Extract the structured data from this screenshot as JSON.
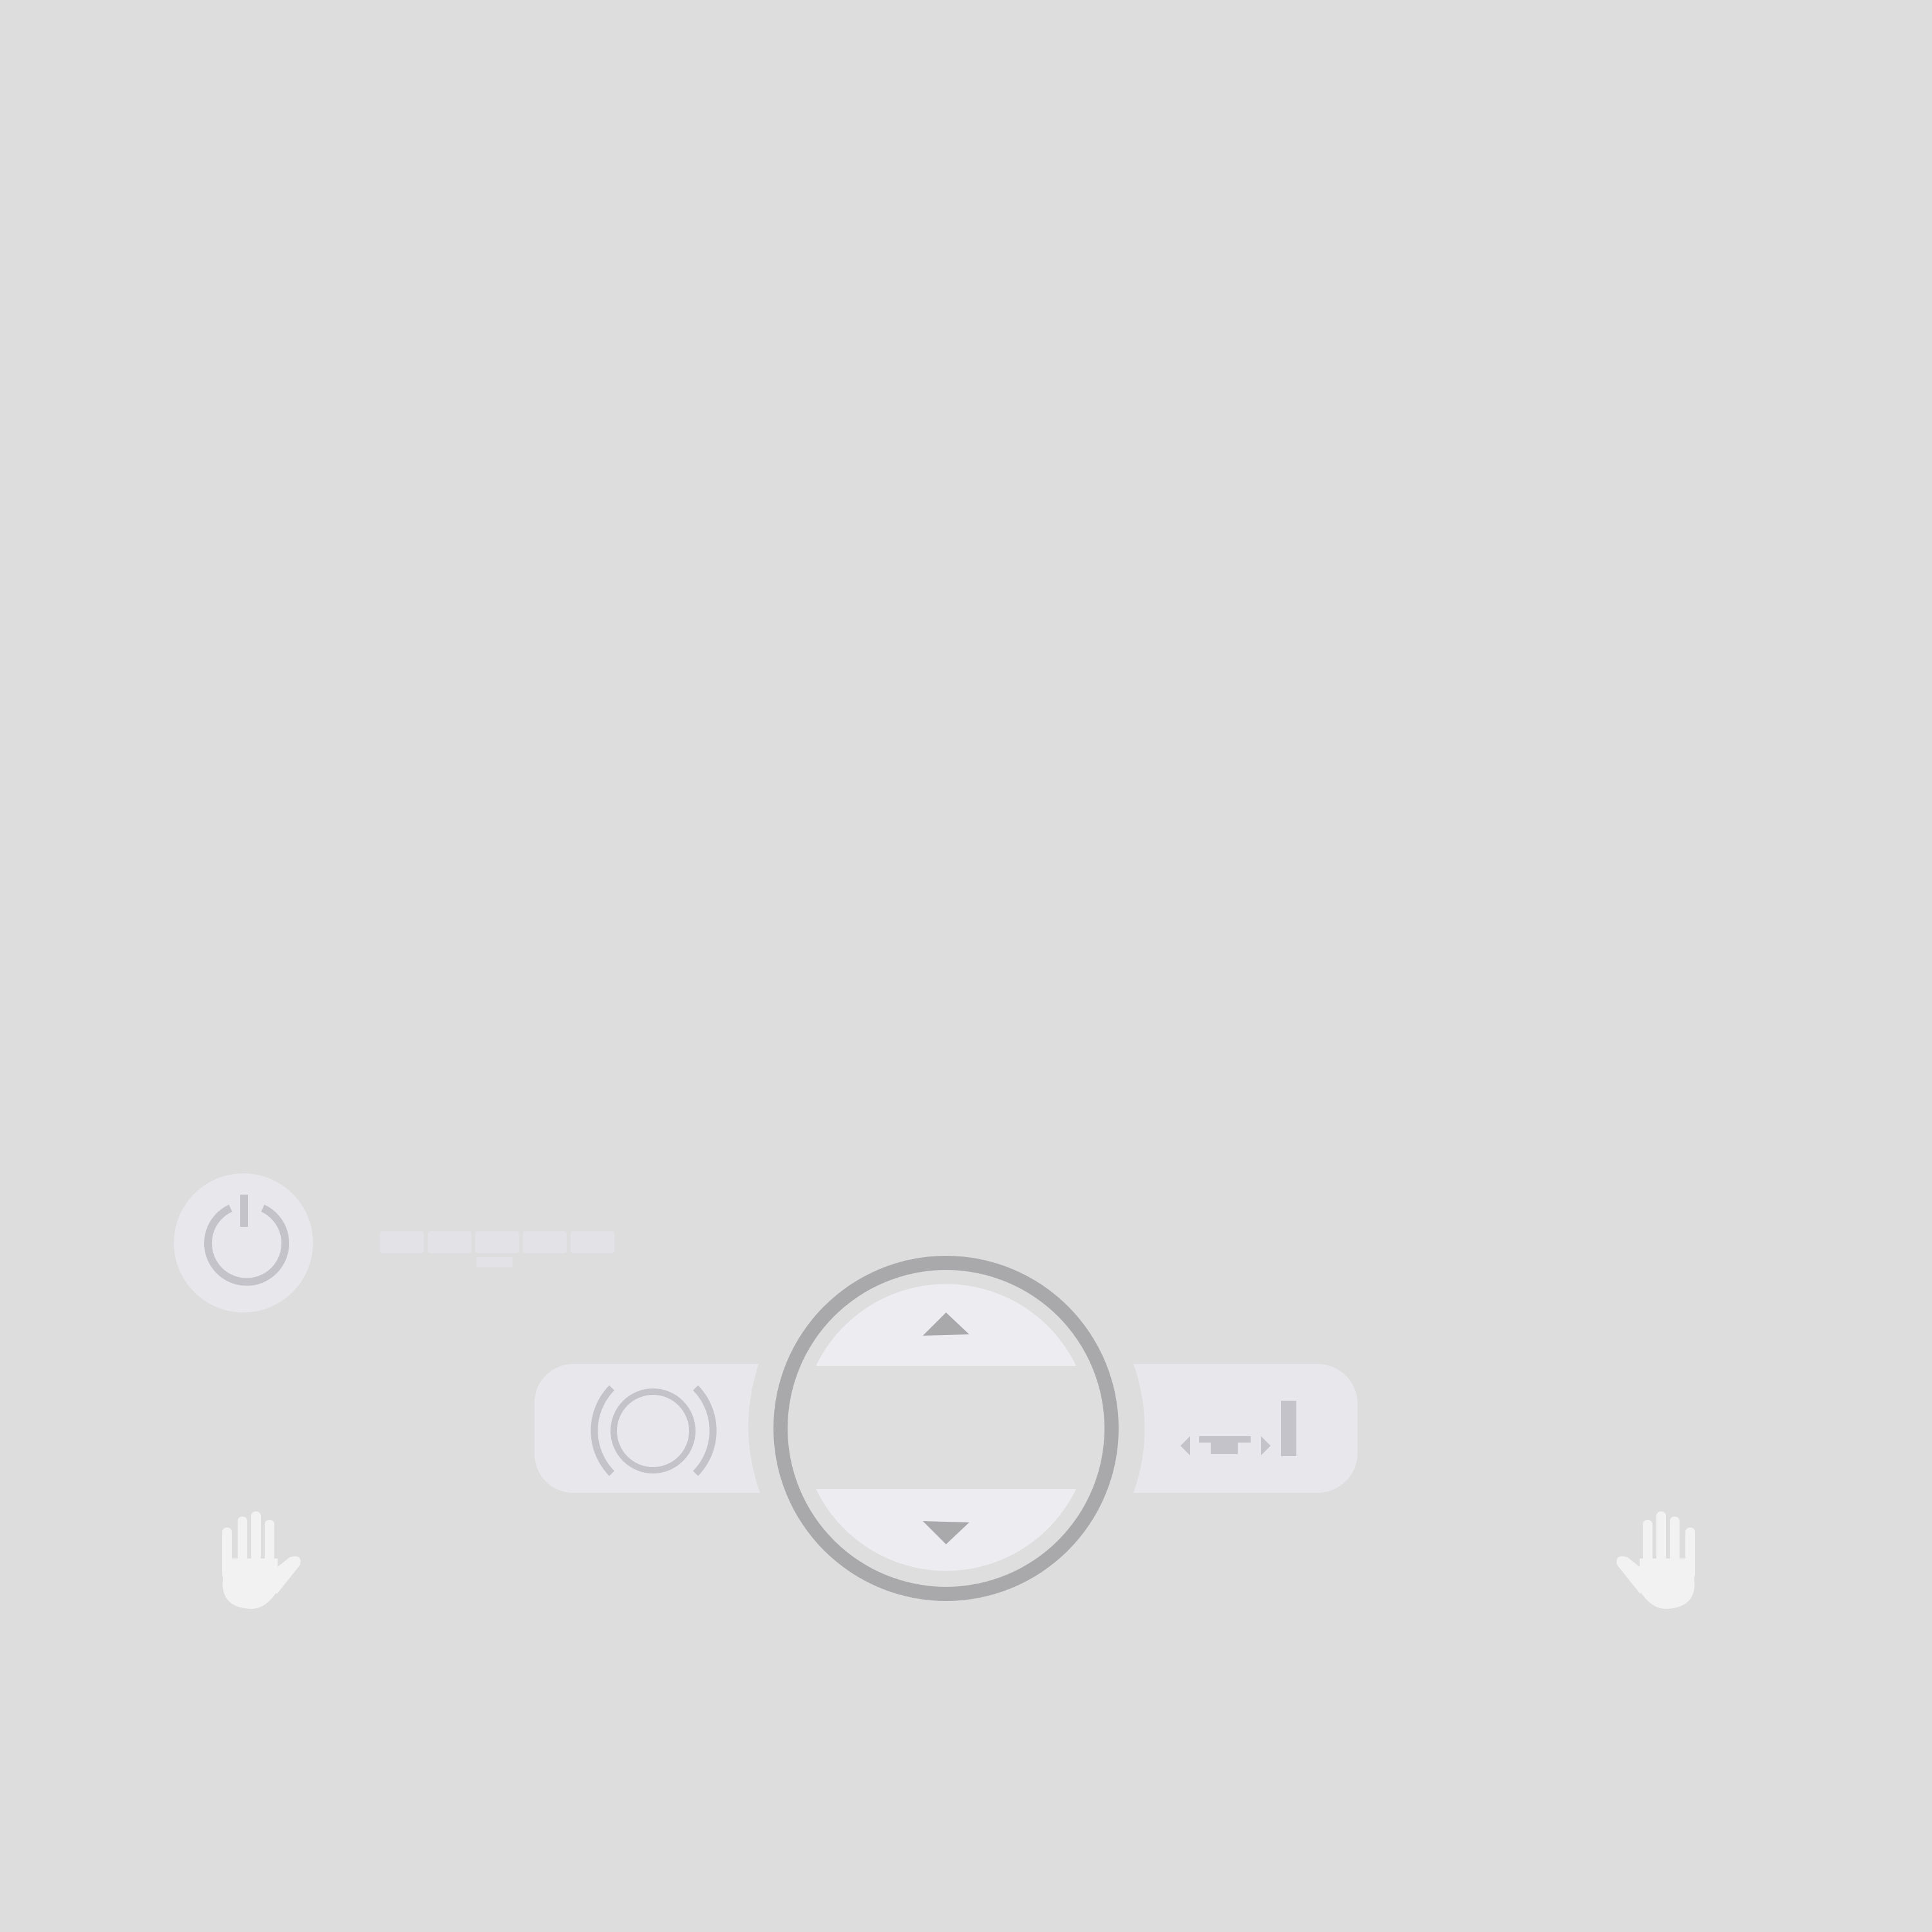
{
  "colors": {
    "background": "#dddddd",
    "panel": "#e8e8ec",
    "button_face": "#ededf1",
    "icon": "#c4c3c9",
    "ring": "#a9a9ac",
    "dpad_center": "#dedede",
    "hand": "#f2f2f2",
    "hint_bar": "#e3e2e6"
  },
  "controls": {
    "power": {
      "icon": "power-icon"
    },
    "status_indicator": {
      "segments": 5
    },
    "wheel_up": {
      "icon": "triangle-up-icon"
    },
    "wheel_down": {
      "icon": "triangle-down-icon"
    },
    "left_pad": {
      "icon": "camera-lens-icon"
    },
    "right_pad": {
      "icon": "return-to-end-icon"
    },
    "left_hand": {
      "icon": "left-hand-icon"
    },
    "right_hand": {
      "icon": "right-hand-icon"
    }
  }
}
